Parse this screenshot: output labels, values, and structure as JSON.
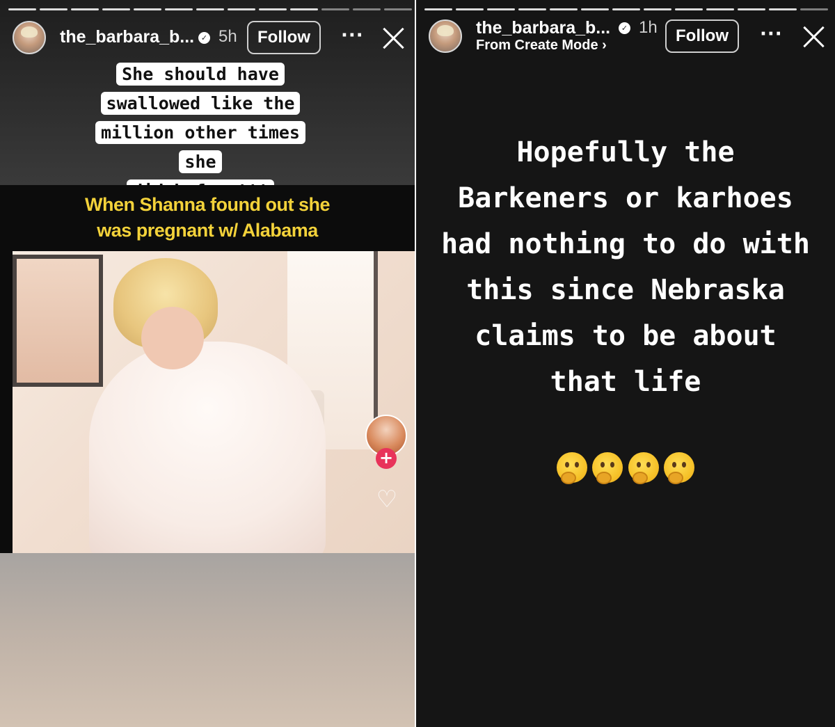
{
  "left_story": {
    "username": "the_barbara_b...",
    "time": "5h",
    "follow_label": "Follow",
    "more_label": "···",
    "caption_lines": [
      "She should have",
      "swallowed like the",
      "million other times she",
      "did before!!!"
    ],
    "video": {
      "caption_lines": [
        "When Shanna found out she",
        "was pregnant w/ Alabama"
      ],
      "plus_label": "+",
      "heart_label": "♡"
    }
  },
  "right_story": {
    "username": "the_barbara_b...",
    "time": "1h",
    "subtitle": "From Create Mode ›",
    "follow_label": "Follow",
    "more_label": "···",
    "text_lines": [
      "Hopefully the",
      "Barkeners or karhoes",
      "had nothing to do with",
      "this since Nebraska",
      "claims to be about",
      "that life"
    ],
    "emoji_icons": [
      "thinking-face",
      "thinking-face",
      "thinking-face",
      "thinking-face"
    ]
  },
  "colors": {
    "video_caption": "#f3d23a",
    "plus_badge": "#e8335a",
    "right_background": "#151515"
  }
}
